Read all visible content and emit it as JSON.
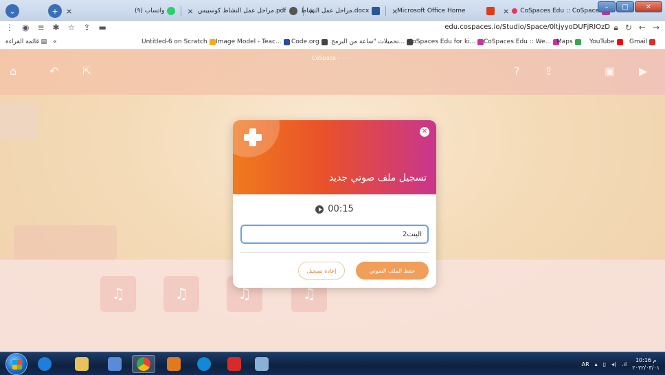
{
  "browser": {
    "tabs": [
      {
        "label": "(٩) واتساب",
        "color": "#25d366"
      },
      {
        "label": "مراحل عمل النشاط كوسبيس.pdf",
        "color": "#555555"
      },
      {
        "label": "مراحل عمل النشاط.docx",
        "color": "#2b579a"
      },
      {
        "label": "Microsoft Office Home",
        "color": "#e03c1a"
      },
      {
        "label": "CoSpaces Edu :: CoSpace",
        "color": "#e8375c"
      }
    ],
    "url": "edu.cospaces.io/Studio/Space/0ltjyyoDUFjRIOzD",
    "bookmarks": [
      {
        "label": "Gmail",
        "color": "#d93025"
      },
      {
        "label": "YouTube",
        "color": "#ff0000"
      },
      {
        "label": "Maps",
        "color": "#34a853"
      },
      {
        "label": "CoSpaces Edu :: We...",
        "color": "#c2389a"
      },
      {
        "label": "CoSpaces Edu for ki...",
        "color": "#c2389a"
      },
      {
        "label": "تحميلات \"ساعة من البرمج...",
        "color": "#444444"
      },
      {
        "label": "Code.org",
        "color": "#444444"
      },
      {
        "label": "Image Model - Teac...",
        "color": "#2b4aa0"
      },
      {
        "label": "Untitled-6 on Scratch",
        "color": "#f8a81c"
      }
    ],
    "reading_list": "قائمة القراءة"
  },
  "app": {
    "title": "CoSpace - ٠٠٠٠"
  },
  "dialog": {
    "title": "تسجيل ملف صوتي جديد",
    "timer": "00:15",
    "input_value": "البنت2",
    "save_label": "حفظ الملف الصوتي",
    "rerecord_label": "إعادة تسجيل"
  },
  "taskbar": {
    "language": "AR",
    "time": "10:16 م",
    "date": "٢٠٢٢/٠٣/٠١"
  }
}
